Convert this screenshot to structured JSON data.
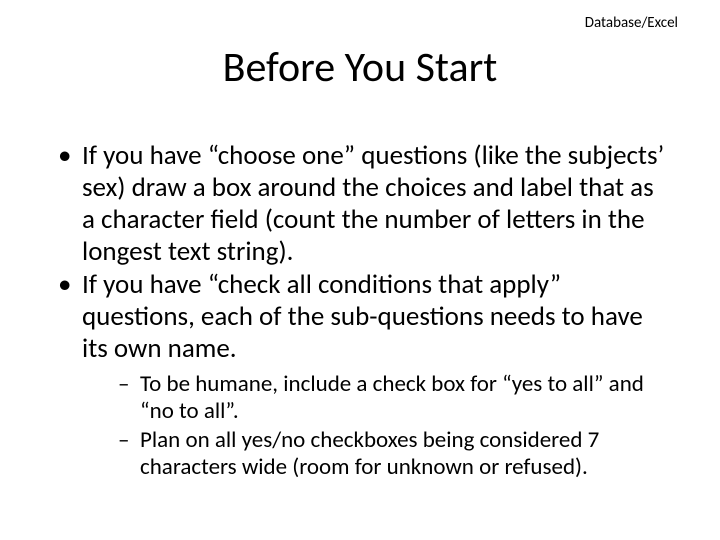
{
  "header": {
    "label": "Database/Excel"
  },
  "title": "Before You Start",
  "bullets": [
    {
      "text": "If you have “choose one” questions (like the subjects’ sex) draw a box around the choices and label that as a character field (count the number of letters in the longest text string)."
    },
    {
      "text": "If you have “check all conditions that apply” questions, each of the sub-questions needs to have its own name.",
      "children": [
        {
          "text": "To be humane, include a check box for “yes to all” and “no to all”."
        },
        {
          "text": "Plan on all yes/no checkboxes being considered 7 characters wide (room for unknown or refused)."
        }
      ]
    }
  ]
}
